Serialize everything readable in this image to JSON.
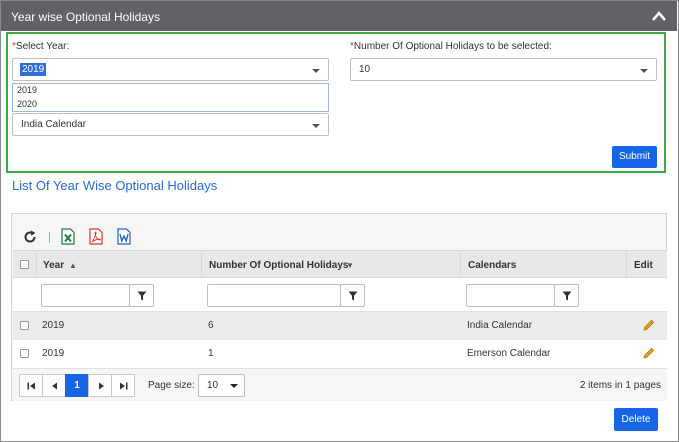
{
  "panel": {
    "title": "Year wise Optional Holidays"
  },
  "form": {
    "year_label": "Select Year:",
    "year_required": "*",
    "year_value": "2019",
    "year_options": [
      "2019",
      "2020"
    ],
    "count_label": "Number Of Optional Holidays to be selected:",
    "count_required": "*",
    "count_value": "10",
    "calendar_value": "India Calendar",
    "submit_label": "Submit"
  },
  "list": {
    "title": "List Of Year Wise Optional Holidays",
    "columns": [
      "Year",
      "Number Of Optional Holidays",
      "Calendars",
      "Edit"
    ],
    "sort_year": "▲",
    "sort_count": "▼",
    "rows": [
      {
        "year": "2019",
        "count": "6",
        "calendar": "India Calendar"
      },
      {
        "year": "2019",
        "count": "1",
        "calendar": "Emerson Calendar"
      }
    ]
  },
  "pager": {
    "current_page": "1",
    "page_size_label": "Page size:",
    "page_size_value": "10",
    "summary": "2 items in 1 pages"
  },
  "delete_label": "Delete",
  "colors": {
    "accent": "#1565e6",
    "header": "#5f6266",
    "focus": "#3dab48",
    "link": "#2a6ccc"
  },
  "icons": [
    "chevron-up-icon",
    "refresh-icon",
    "excel-icon",
    "pdf-icon",
    "word-icon",
    "filter-icon",
    "pencil-icon",
    "first-page-icon",
    "prev-page-icon",
    "next-page-icon",
    "last-page-icon"
  ]
}
